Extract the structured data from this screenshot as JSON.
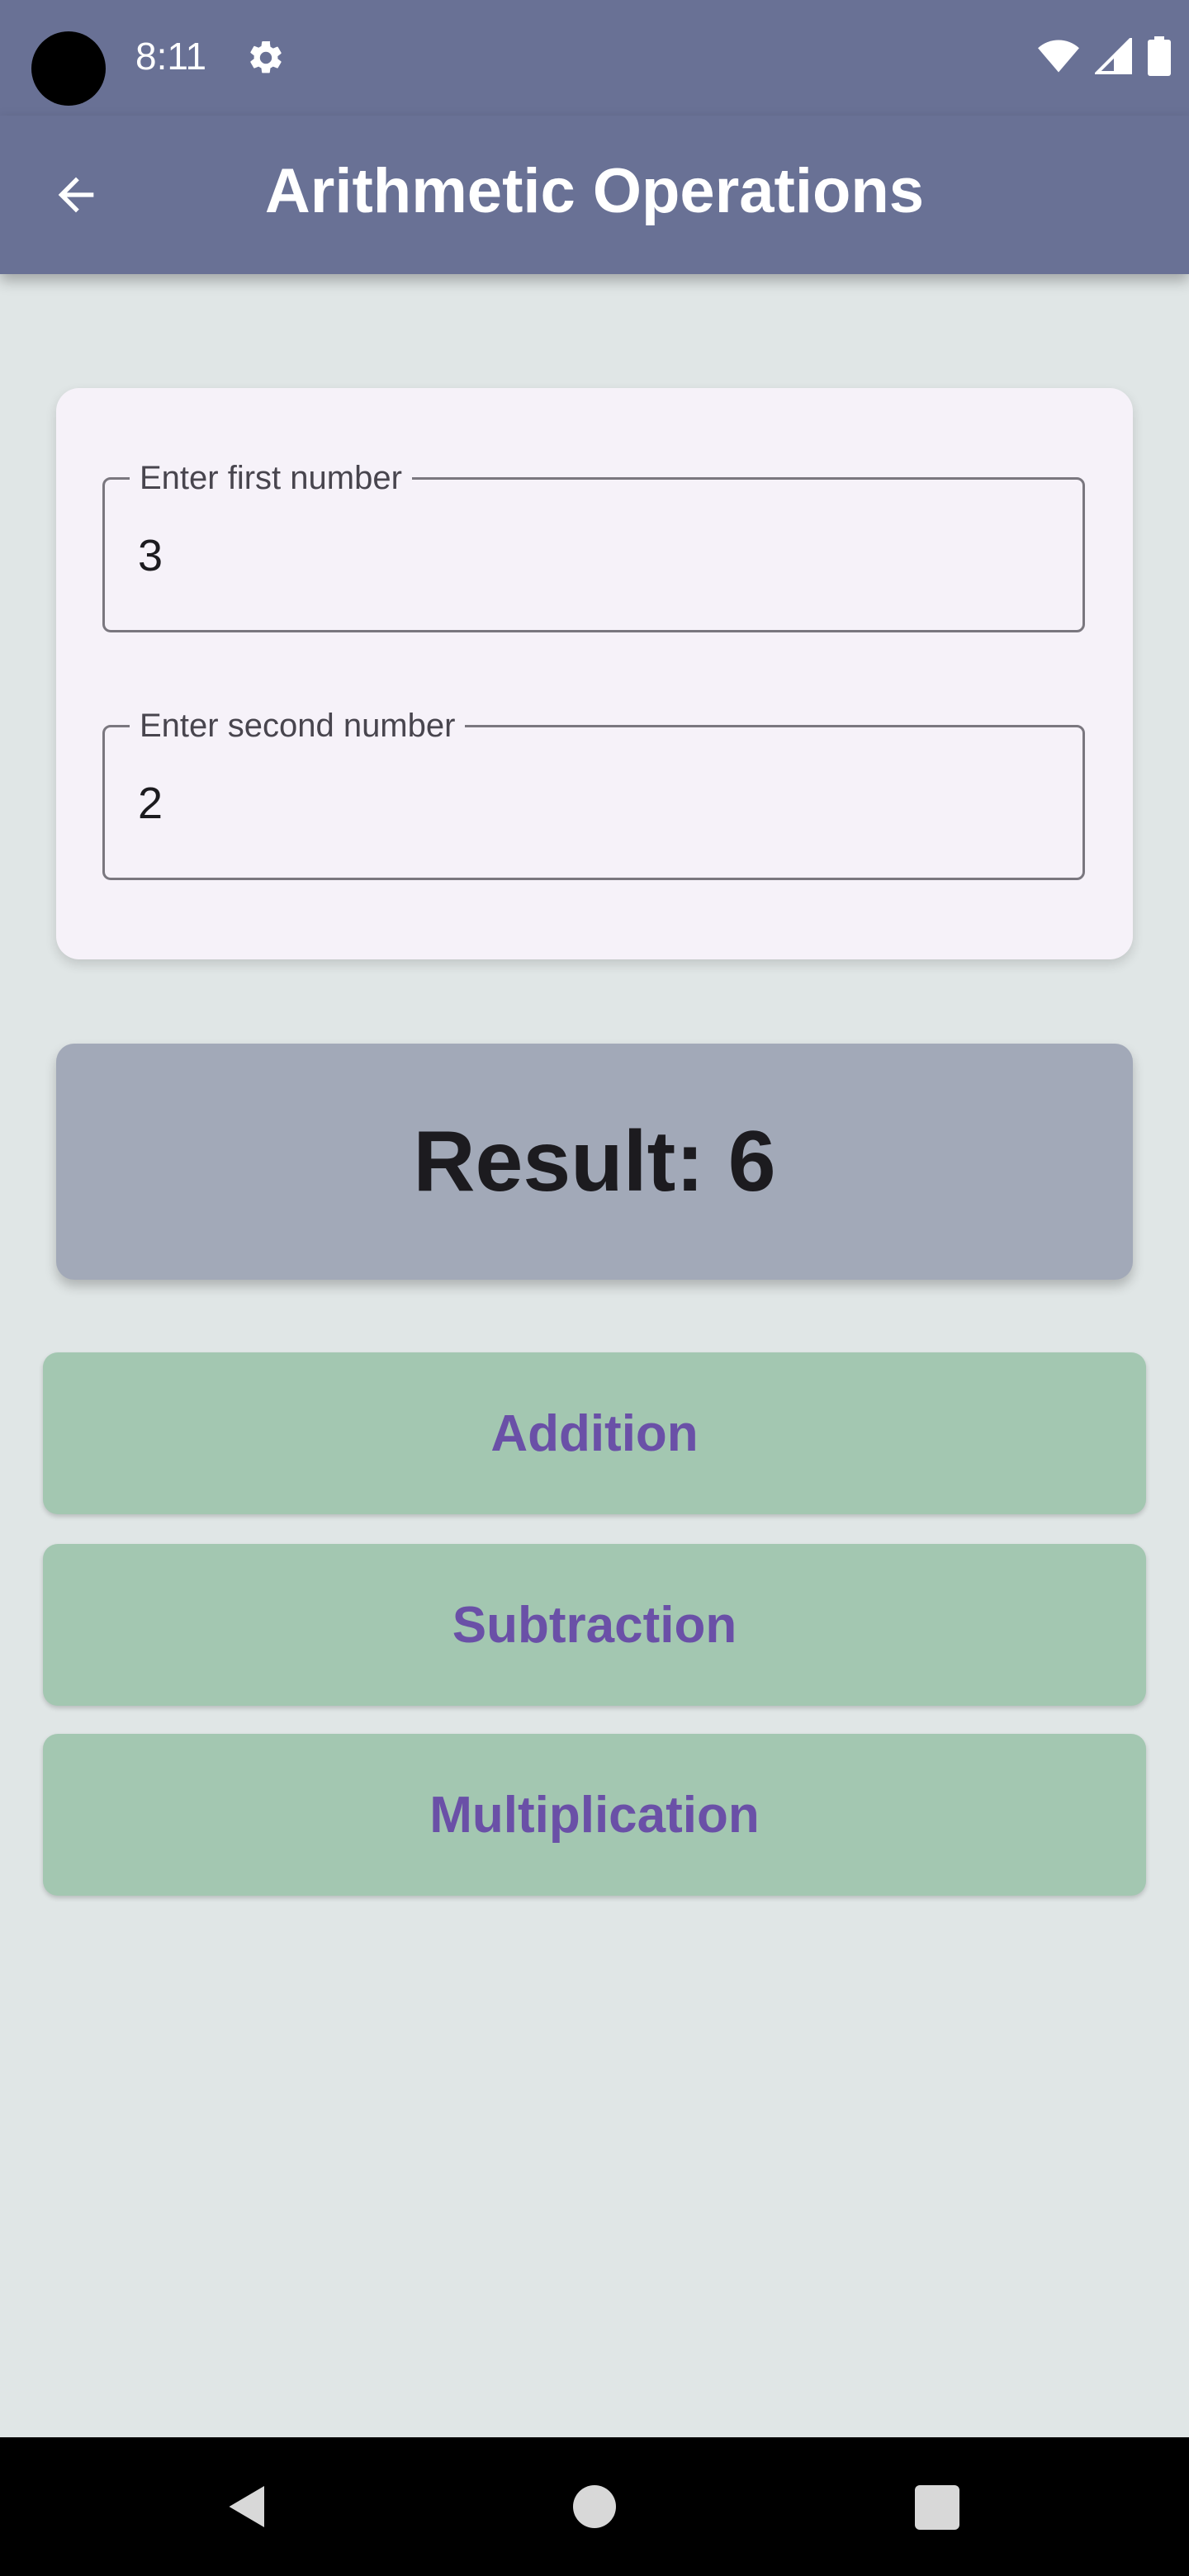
{
  "status_bar": {
    "time": "8:11",
    "icons": [
      "settings-gear-icon",
      "wifi-icon",
      "cell-signal-icon",
      "battery-icon"
    ]
  },
  "app_bar": {
    "title": "Arithmetic Operations",
    "back_icon": "arrow-back-icon"
  },
  "inputs": {
    "first": {
      "label": "Enter first number",
      "value": "3"
    },
    "second": {
      "label": "Enter second number",
      "value": "2"
    }
  },
  "result": {
    "text": "Result: 6"
  },
  "operations": {
    "addition": "Addition",
    "subtraction": "Subtraction",
    "multiplication": "Multiplication"
  },
  "nav_bar": {
    "icons": [
      "nav-back-icon",
      "nav-home-icon",
      "nav-recents-icon"
    ]
  },
  "colors": {
    "app_bar": "#697195",
    "background": "#e0e6e6",
    "card": "#f6f2f9",
    "result_card": "#a2a9b8",
    "button": "#a3c7b1",
    "button_text": "#6a50a7"
  }
}
